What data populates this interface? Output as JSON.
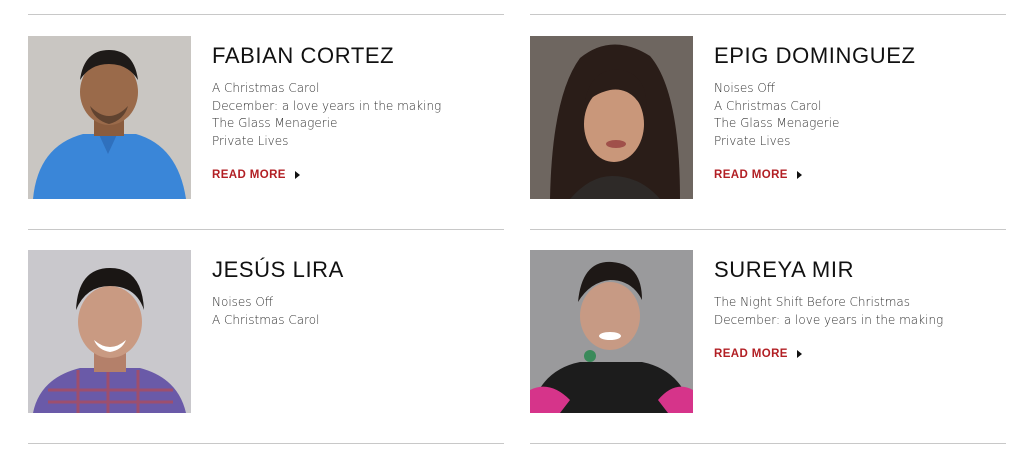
{
  "actors": [
    {
      "name": "FABIAN CORTEZ",
      "shows": [
        "A Christmas Carol",
        "December: a love years in the making",
        "The Glass Menagerie",
        "Private Lives"
      ],
      "read_more": "READ MORE",
      "shirt_color": "#3a86d8"
    },
    {
      "name": "EPIG DOMINGUEZ",
      "shows": [
        "Noises Off",
        "A Christmas Carol",
        "The Glass Menagerie",
        "Private Lives"
      ],
      "read_more": "READ MORE",
      "shirt_color": "#2e2a28"
    },
    {
      "name": "JESÚS LIRA",
      "shows": [
        "Noises Off",
        "A Christmas Carol"
      ],
      "shirt_color": "#6a5aa8"
    },
    {
      "name": "SUREYA MIR",
      "shows": [
        "The Night Shift Before Christmas",
        "December: a love years in the making"
      ],
      "read_more": "READ MORE",
      "shirt_color": "#1c1c1c"
    }
  ],
  "colors": {
    "accent": "#b21f24",
    "divider": "#c8c8c8"
  },
  "icons": {
    "read_more_arrow": "play-triangle-icon"
  }
}
